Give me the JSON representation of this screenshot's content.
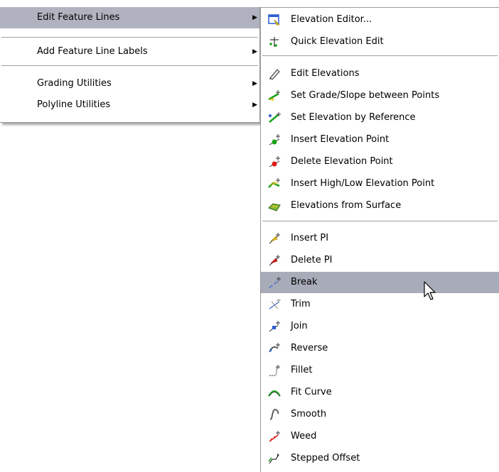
{
  "left_menu": {
    "items": [
      {
        "label": "Edit Feature Lines",
        "has_submenu": true
      },
      {
        "label": "Add Feature Line Labels",
        "has_submenu": true
      },
      {
        "label": "Grading Utilities",
        "has_submenu": true
      },
      {
        "label": "Polyline Utilities",
        "has_submenu": true
      }
    ],
    "submenu_arrow": "▶"
  },
  "right_menu": {
    "items": [
      {
        "label": "Elevation Editor...",
        "icon": "elevation-editor-icon"
      },
      {
        "label": "Quick Elevation Edit",
        "icon": "quick-elevation-edit-icon"
      },
      {
        "label": "Edit Elevations",
        "icon": "pencil-icon"
      },
      {
        "label": "Set Grade/Slope between Points",
        "icon": "set-grade-slope-icon"
      },
      {
        "label": "Set Elevation by Reference",
        "icon": "set-elevation-reference-icon"
      },
      {
        "label": "Insert Elevation Point",
        "icon": "insert-elevation-point-icon"
      },
      {
        "label": "Delete Elevation Point",
        "icon": "delete-elevation-point-icon"
      },
      {
        "label": "Insert High/Low Elevation Point",
        "icon": "insert-high-low-point-icon"
      },
      {
        "label": "Elevations from Surface",
        "icon": "elevations-from-surface-icon"
      },
      {
        "label": "Insert PI",
        "icon": "insert-pi-icon"
      },
      {
        "label": "Delete PI",
        "icon": "delete-pi-icon"
      },
      {
        "label": "Break",
        "icon": "break-icon"
      },
      {
        "label": "Trim",
        "icon": "trim-icon"
      },
      {
        "label": "Join",
        "icon": "join-icon"
      },
      {
        "label": "Reverse",
        "icon": "reverse-icon"
      },
      {
        "label": "Fillet",
        "icon": "fillet-icon"
      },
      {
        "label": "Fit Curve",
        "icon": "fit-curve-icon"
      },
      {
        "label": "Smooth",
        "icon": "smooth-icon"
      },
      {
        "label": "Weed",
        "icon": "weed-icon"
      },
      {
        "label": "Stepped Offset",
        "icon": "stepped-offset-icon"
      }
    ],
    "highlighted_item": "Break"
  },
  "colors": {
    "highlight": "#a8abb8",
    "left_highlight": "#b0b3bf",
    "green": "#19a319",
    "red": "#e01818",
    "blue": "#2c5fd4",
    "yellow": "#e8c21a"
  }
}
